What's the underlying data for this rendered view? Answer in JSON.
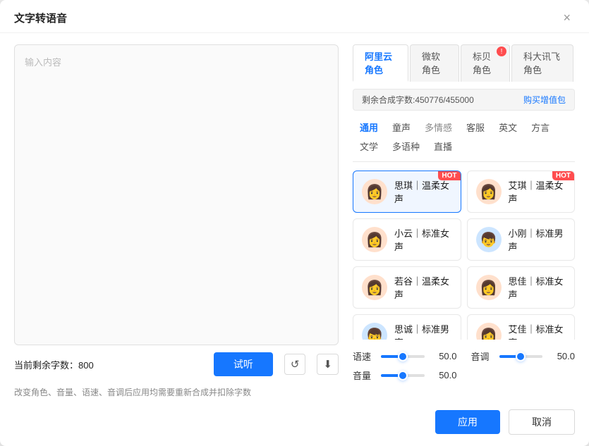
{
  "dialog": {
    "title": "文字转语音",
    "close_label": "×"
  },
  "left": {
    "textarea_placeholder": "输入内容",
    "remaining_label": "当前剩余字数：",
    "remaining_value": "800",
    "btn_trial": "试听",
    "btn_history_icon": "↺",
    "btn_download_icon": "⬇",
    "note": "改变角色、音量、语速、音调后应用均需要重新合成并扣除字数"
  },
  "right": {
    "provider_tabs": [
      {
        "id": "alibaba",
        "label": "阿里云角色",
        "active": true,
        "badge": null
      },
      {
        "id": "microsoft",
        "label": "微软角色",
        "active": false,
        "badge": null
      },
      {
        "id": "biaobei",
        "label": "标贝角色",
        "active": false,
        "badge": "!"
      },
      {
        "id": "iflytek",
        "label": "科大讯飞角色",
        "active": false,
        "badge": null
      }
    ],
    "quota_text": "剩余合成字数:450776/455000",
    "quota_link": "购买增值包",
    "category_tabs": [
      {
        "id": "general",
        "label": "通用",
        "active": true
      },
      {
        "id": "child",
        "label": "童声",
        "active": false
      },
      {
        "id": "emotion",
        "label": "多情感",
        "active": false
      },
      {
        "id": "service",
        "label": "客服",
        "active": false
      },
      {
        "id": "english",
        "label": "英文",
        "active": false
      },
      {
        "id": "dialect",
        "label": "方言",
        "active": false
      },
      {
        "id": "literature",
        "label": "文学",
        "active": false
      },
      {
        "id": "multilang",
        "label": "多语种",
        "active": false
      },
      {
        "id": "live",
        "label": "直播",
        "active": false
      }
    ],
    "voice_cards": [
      {
        "id": "siqin",
        "name": "思琪｜温柔女声",
        "hot": true,
        "selected": true,
        "avatar": "👩",
        "avatar_bg": "female"
      },
      {
        "id": "aizhen",
        "name": "艾琪｜温柔女声",
        "hot": true,
        "selected": false,
        "avatar": "👩",
        "avatar_bg": "female"
      },
      {
        "id": "xiaoyun",
        "name": "小云｜标准女声",
        "hot": false,
        "selected": false,
        "avatar": "👩",
        "avatar_bg": "female"
      },
      {
        "id": "xiaogang",
        "name": "小刚｜标准男声",
        "hot": false,
        "selected": false,
        "avatar": "👦",
        "avatar_bg": "male"
      },
      {
        "id": "ruogu",
        "name": "若谷｜温柔女声",
        "hot": false,
        "selected": false,
        "avatar": "👩",
        "avatar_bg": "female"
      },
      {
        "id": "sijia",
        "name": "思佳｜标准女声",
        "hot": false,
        "selected": false,
        "avatar": "👩",
        "avatar_bg": "female"
      },
      {
        "id": "sicheng",
        "name": "思诚｜标准男声",
        "hot": false,
        "selected": false,
        "avatar": "👦",
        "avatar_bg": "male"
      },
      {
        "id": "aijia",
        "name": "艾佳｜标准女声",
        "hot": false,
        "selected": false,
        "avatar": "👩",
        "avatar_bg": "female"
      }
    ],
    "sliders": {
      "speed_label": "语速",
      "speed_value": "50.0",
      "speed_pct": 50,
      "pitch_label": "音调",
      "pitch_value": "50.0",
      "pitch_pct": 50,
      "volume_label": "音量",
      "volume_value": "50.0",
      "volume_pct": 50
    }
  },
  "footer": {
    "apply_label": "应用",
    "cancel_label": "取消"
  }
}
